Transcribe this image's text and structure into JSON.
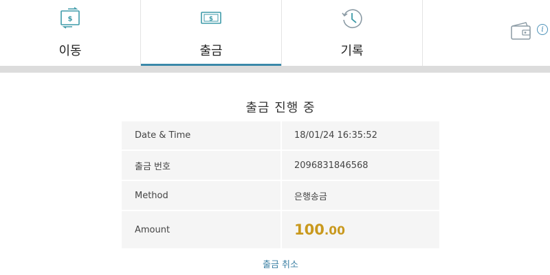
{
  "tabs": [
    {
      "label": "이동",
      "icon": "transfer-icon"
    },
    {
      "label": "출금",
      "icon": "withdraw-icon",
      "active": true
    },
    {
      "label": "기록",
      "icon": "history-icon"
    }
  ],
  "header_icons": {
    "wallet": "wallet-icon",
    "info": "i"
  },
  "page_title": "출금 진행 중",
  "details": {
    "rows": [
      {
        "label": "Date & Time",
        "value": "18/01/24 16:35:52"
      },
      {
        "label": "출금 번호",
        "value": "2096831846568"
      },
      {
        "label": "Method",
        "value": "은행송금"
      },
      {
        "label": "Amount",
        "value_int": "100",
        "value_dec": ".00"
      }
    ]
  },
  "cancel_label": "출금 취소",
  "colors": {
    "accent": "#3a88a9",
    "amount": "#c9991e",
    "icon_teal": "#3d9aa8"
  }
}
